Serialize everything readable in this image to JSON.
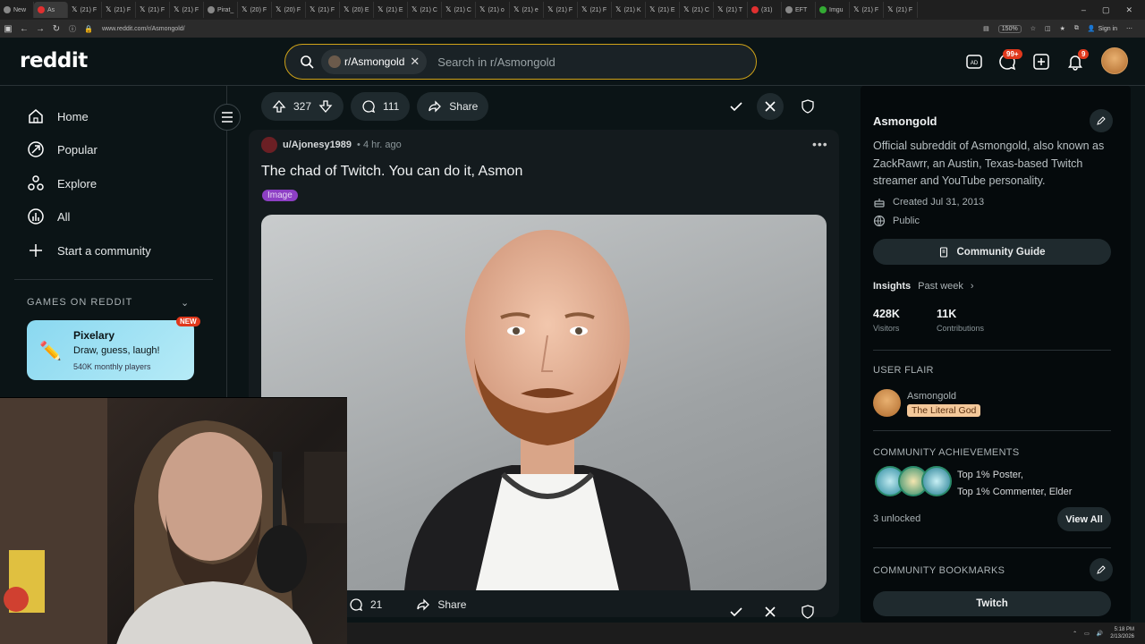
{
  "browser": {
    "tabs": [
      {
        "label": "New",
        "icon": "fav"
      },
      {
        "label": "As",
        "icon": "red",
        "active": true
      },
      {
        "label": "(21) F",
        "icon": "x"
      },
      {
        "label": "(21) F",
        "icon": "x"
      },
      {
        "label": "(21) F",
        "icon": "x"
      },
      {
        "label": "(21) F",
        "icon": "x"
      },
      {
        "label": "Pirat_",
        "icon": "fav"
      },
      {
        "label": "(20) F",
        "icon": "x"
      },
      {
        "label": "(20) F",
        "icon": "x"
      },
      {
        "label": "(21) F",
        "icon": "x"
      },
      {
        "label": "(20) E",
        "icon": "x"
      },
      {
        "label": "(21) E",
        "icon": "x"
      },
      {
        "label": "(21) C",
        "icon": "x"
      },
      {
        "label": "(21) C",
        "icon": "x"
      },
      {
        "label": "(21) o",
        "icon": "x"
      },
      {
        "label": "(21) e",
        "icon": "x"
      },
      {
        "label": "(21) F",
        "icon": "x"
      },
      {
        "label": "(21) F",
        "icon": "x"
      },
      {
        "label": "(21) K",
        "icon": "x"
      },
      {
        "label": "(21) E",
        "icon": "x"
      },
      {
        "label": "(21) C",
        "icon": "x"
      },
      {
        "label": "(21) T",
        "icon": "x"
      },
      {
        "label": "(31) ",
        "icon": "red"
      },
      {
        "label": "EFT",
        "icon": "fav"
      },
      {
        "label": "Imgu",
        "icon": "green"
      },
      {
        "label": "(21) F",
        "icon": "x"
      },
      {
        "label": "(21) F",
        "icon": "x"
      }
    ],
    "url": "www.reddit.com/r/Asmongold/",
    "zoom": "150%",
    "signin": "Sign in"
  },
  "header": {
    "logo": "reddit",
    "search_chip": "r/Asmongold",
    "search_placeholder": "Search in r/Asmongold",
    "chat_badge": "99+",
    "notif_badge": "9"
  },
  "sidebar": {
    "items": [
      {
        "label": "Home"
      },
      {
        "label": "Popular"
      },
      {
        "label": "Explore"
      },
      {
        "label": "All"
      },
      {
        "label": "Start a community"
      }
    ],
    "games_header": "GAMES ON REDDIT",
    "game": {
      "title": "Pixelary",
      "subtitle": "Draw, guess, laugh!",
      "players": "540K monthly players",
      "badge": "NEW"
    }
  },
  "post_top_actions": {
    "votes": "327",
    "comments": "111",
    "share": "Share"
  },
  "post": {
    "author": "u/Ajonesy1989",
    "time": "• 4 hr. ago",
    "title": "The chad of Twitch. You can do it, Asmon",
    "flair": "Image"
  },
  "post_bottom_actions": {
    "comments": "21",
    "share": "Share"
  },
  "community": {
    "name": "Asmongold",
    "description": "Official subreddit of Asmongold, also known as ZackRawrr, an Austin, Texas-based Twitch streamer and YouTube personality.",
    "created": "Created Jul 31, 2013",
    "visibility": "Public",
    "guide_button": "Community Guide",
    "insights_label": "Insights",
    "insights_period": "Past week",
    "stats": [
      {
        "value": "428K",
        "label": "Visitors"
      },
      {
        "value": "11K",
        "label": "Contributions"
      }
    ],
    "user_flair_header": "USER FLAIR",
    "flair_user": "Asmongold",
    "flair_text": "The Literal God",
    "achievements_header": "COMMUNITY ACHIEVEMENTS",
    "achievements_line1": "Top 1% Poster,",
    "achievements_line2": "Top 1% Commenter, Elder",
    "unlocked": "3 unlocked",
    "view_all": "View All",
    "bookmarks_header": "COMMUNITY BOOKMARKS",
    "bookmark": "Twitch"
  },
  "taskbar": {
    "time": "5:18 PM",
    "date": "2/13/2026"
  },
  "colors": {
    "search_border": "#d0a318",
    "flair_purple": "#8d3fc4",
    "badge_red": "#e0381c"
  }
}
